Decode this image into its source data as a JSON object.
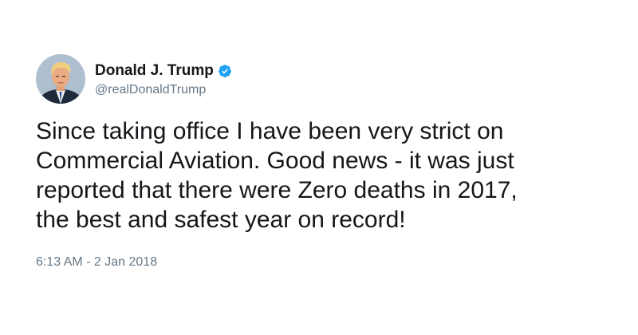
{
  "user": {
    "display_name": "Donald J. Trump",
    "handle": "@realDonaldTrump",
    "verified": true,
    "avatar_icon": "profile-photo",
    "verified_icon": "verified-badge-icon",
    "verified_color": "#1da1f2"
  },
  "tweet": {
    "text": "Since taking office I have been very strict on\nCommercial Aviation. Good news - it was just\nreported that there were Zero deaths in 2017,\nthe best and safest year on record!",
    "timestamp": "6:13 AM - 2 Jan 2018"
  },
  "colors": {
    "text": "#14171a",
    "secondary": "#657786",
    "background": "#ffffff"
  }
}
